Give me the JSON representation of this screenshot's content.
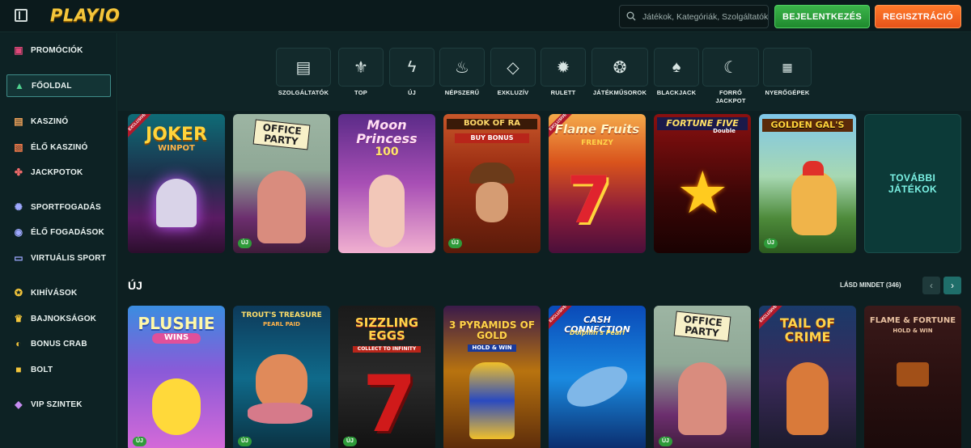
{
  "header": {
    "logo_text": "PLAYIO",
    "search_placeholder": "Játékok, Kategóriák, Szolgáltatók",
    "login_label": "BEJELENTKEZÉS",
    "register_label": "REGISZTRÁCIÓ"
  },
  "sidebar": {
    "items": [
      {
        "label": "PROMÓCIÓK",
        "icon": "gift-icon"
      },
      {
        "label": "FŐOLDAL",
        "icon": "home-icon"
      },
      {
        "label": "KASZINÓ",
        "icon": "casino-icon"
      },
      {
        "label": "ÉLŐ KASZINÓ",
        "icon": "cards-icon"
      },
      {
        "label": "JACKPOTOK",
        "icon": "clover-icon"
      },
      {
        "label": "SPORTFOGADÁS",
        "icon": "ball-icon"
      },
      {
        "label": "ÉLŐ FOGADÁSOK",
        "icon": "live-icon"
      },
      {
        "label": "VIRTUÁLIS SPORT",
        "icon": "gamepad-icon"
      },
      {
        "label": "KIHÍVÁSOK",
        "icon": "medal-icon"
      },
      {
        "label": "BAJNOKSÁGOK",
        "icon": "trophy-icon"
      },
      {
        "label": "BONUS CRAB",
        "icon": "crab-icon"
      },
      {
        "label": "BOLT",
        "icon": "shop-icon"
      },
      {
        "label": "VIP SZINTEK",
        "icon": "diamond-icon"
      }
    ]
  },
  "categories": [
    {
      "label": "SZOLGÁLTATÓK",
      "icon": "provider-icon"
    },
    {
      "label": "TOP",
      "icon": "fleur-icon"
    },
    {
      "label": "ÚJ",
      "icon": "bolt-icon"
    },
    {
      "label": "NÉPSZERŰ",
      "icon": "flame-icon"
    },
    {
      "label": "EXKLUZÍV",
      "icon": "diamond-icon"
    },
    {
      "label": "RULETT",
      "icon": "roulette-icon"
    },
    {
      "label": "JÁTÉKMŰSOROK",
      "icon": "wheel-icon"
    },
    {
      "label": "BLACKJACK",
      "icon": "spade-icon"
    },
    {
      "label": "FORRÓ\nJACKPOT",
      "icon": "hot-jackpot-icon"
    },
    {
      "label": "NYERŐGÉPEK",
      "icon": "slot-icon"
    }
  ],
  "top_games": [
    {
      "title": "JOKER",
      "subtitle": "WINPOT",
      "new": false,
      "exclusive": true
    },
    {
      "title": "OFFICE PARTY",
      "subtitle": "",
      "new": true,
      "exclusive": false
    },
    {
      "title": "Moon Princess",
      "subtitle": "100",
      "new": false,
      "exclusive": false
    },
    {
      "title": "BOOK OF RA",
      "subtitle": "BUY BONUS",
      "new": true,
      "exclusive": false
    },
    {
      "title": "Flame Fruits",
      "subtitle": "FRENZY",
      "new": false,
      "exclusive": true
    },
    {
      "title": "FORTUNE FIVE",
      "subtitle": "Double",
      "new": false,
      "exclusive": false
    },
    {
      "title": "GOLDEN GAL'S",
      "subtitle": "",
      "new": true,
      "exclusive": false
    }
  ],
  "more_label": "TOVÁBBI\nJÁTÉKOK",
  "new_section": {
    "title": "ÚJ",
    "see_all": "LÁSD MINDET (346)"
  },
  "new_games": [
    {
      "title": "PLUSHIE",
      "subtitle": "WINS",
      "new": true
    },
    {
      "title": "TROUT'S TREASURE",
      "subtitle": "PEARL PAID",
      "new": true
    },
    {
      "title": "SIZZLING EGGS",
      "subtitle": "COLLECT TO INFINITY",
      "new": true
    },
    {
      "title": "3 PYRAMIDS OF GOLD",
      "subtitle": "HOLD & WIN",
      "new": false
    },
    {
      "title": "CASH CONNECTION",
      "subtitle": "Dolphin's Pearl",
      "new": false
    },
    {
      "title": "OFFICE PARTY",
      "subtitle": "",
      "new": true
    },
    {
      "title": "TAIL OF CRIME",
      "subtitle": "",
      "new": false
    },
    {
      "title": "FLAME & FORTUNE",
      "subtitle": "HOLD & WIN",
      "new": false
    }
  ],
  "badge_text": "ÚJ",
  "exclusive_text": "EXCLUSIVE",
  "exclusive2_text": "EXCLUSIVE",
  "ribbon_text": "EXCLUSIVE"
}
